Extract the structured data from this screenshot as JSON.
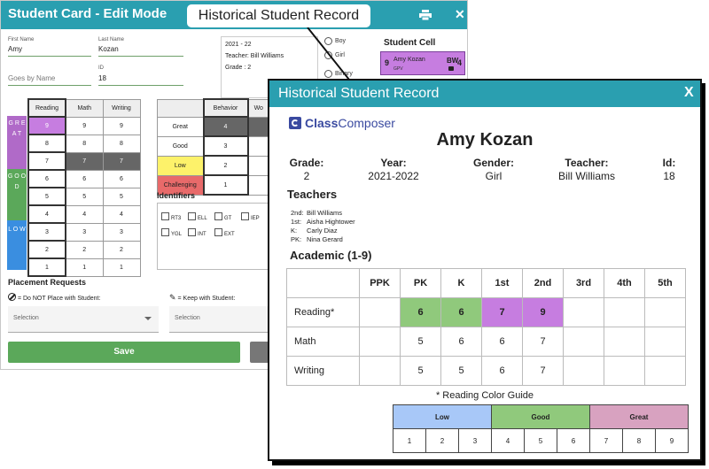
{
  "student_card": {
    "title": "Student Card - Edit Mode",
    "first_name_label": "First Name",
    "first_name_value": "Amy",
    "last_name_label": "Last Name",
    "last_name_value": "Kozan",
    "goes_by_placeholder": "Goes by Name",
    "id_label": "ID",
    "id_value": "18",
    "info_box": {
      "year": "2021 - 22",
      "teacher": "Teacher: Bill Williams",
      "grade": "Grade : 2"
    },
    "gender_options": [
      "Boy",
      "Girl",
      "Binary"
    ],
    "student_cell_title": "Student Cell",
    "student_cell": {
      "left_num": "9",
      "name": "Amy Kozan",
      "initials": "BW",
      "right_num": "4",
      "tag": "GPV"
    },
    "academic_headers": [
      "Reading",
      "Math",
      "Writing"
    ],
    "academic_rows": [
      [
        "9",
        "9",
        "9"
      ],
      [
        "8",
        "8",
        "8"
      ],
      [
        "7",
        "7",
        "7"
      ],
      [
        "6",
        "6",
        "6"
      ],
      [
        "5",
        "5",
        "5"
      ],
      [
        "4",
        "4",
        "4"
      ],
      [
        "3",
        "3",
        "3"
      ],
      [
        "2",
        "2",
        "2"
      ],
      [
        "1",
        "1",
        "1"
      ]
    ],
    "side_bands": [
      {
        "label": "G R E A T",
        "color": "#b06ac8"
      },
      {
        "label": "G O O D",
        "color": "#5ba85a"
      },
      {
        "label": "L O W",
        "color": "#3a8ee0"
      }
    ],
    "behavior_header": "Behavior",
    "behavior_next_header": "Wo",
    "behavior_rows": [
      {
        "label": "Great",
        "value": "4",
        "color": "#ffffff"
      },
      {
        "label": "Good",
        "value": "3",
        "color": "#ffffff"
      },
      {
        "label": "Low",
        "value": "2",
        "color": "#fdf26a"
      },
      {
        "label": "Challenging",
        "value": "1",
        "color": "#e86a6a"
      }
    ],
    "identifiers_title": "Identifiers",
    "identifiers": [
      "RT3",
      "ELL",
      "GT",
      "IEP",
      "YGL",
      "INT",
      "EXT"
    ],
    "placement_title": "Placement Requests",
    "do_not_place_label": "= Do NOT Place with Student:",
    "keep_with_label": "= Keep with Student:",
    "selection_placeholder": "Selection",
    "save_label": "Save"
  },
  "callout": {
    "text": "Historical Student Record"
  },
  "historical_record": {
    "title": "Historical Student Record",
    "close": "X",
    "logo": {
      "brand_bold": "Class",
      "brand_rest": "Composer"
    },
    "student_name": "Amy Kozan",
    "info": [
      {
        "label": "Grade:",
        "value": "2"
      },
      {
        "label": "Year:",
        "value": "2021-2022"
      },
      {
        "label": "Gender:",
        "value": "Girl"
      },
      {
        "label": "Teacher:",
        "value": "Bill Williams"
      },
      {
        "label": "Id:",
        "value": "18"
      }
    ],
    "teachers_heading": "Teachers",
    "teachers": [
      {
        "grade": "2nd:",
        "name": "Bill Williams"
      },
      {
        "grade": "1st:",
        "name": "Aisha Hightower"
      },
      {
        "grade": "K:",
        "name": "Carly Diaz"
      },
      {
        "grade": "PK:",
        "name": "Nina Gerard"
      }
    ],
    "academic_heading": "Academic (1-9)",
    "academic_columns": [
      "PPK",
      "PK",
      "K",
      "1st",
      "2nd",
      "3rd",
      "4th",
      "5th"
    ],
    "academic_rows": [
      {
        "label": "Reading*",
        "values": [
          "",
          "6",
          "6",
          "7",
          "9",
          "",
          "",
          ""
        ]
      },
      {
        "label": "Math",
        "values": [
          "",
          "5",
          "6",
          "6",
          "7",
          "",
          "",
          ""
        ]
      },
      {
        "label": "Writing",
        "values": [
          "",
          "5",
          "5",
          "6",
          "7",
          "",
          "",
          ""
        ]
      }
    ],
    "guide_title": "* Reading Color Guide",
    "guide_bands": [
      {
        "label": "Low",
        "color": "#a8c8f8"
      },
      {
        "label": "Good",
        "color": "#90c97c"
      },
      {
        "label": "Great",
        "color": "#d8a2c0"
      }
    ],
    "guide_numbers": [
      "1",
      "2",
      "3",
      "4",
      "5",
      "6",
      "7",
      "8",
      "9"
    ]
  }
}
